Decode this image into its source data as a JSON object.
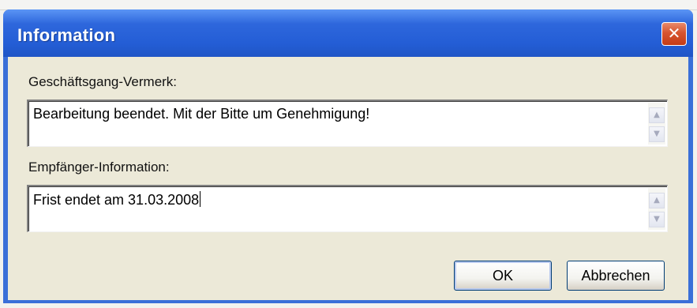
{
  "window": {
    "title": "Information",
    "close_symbol": "✕"
  },
  "fields": {
    "remark_label": "Geschäftsgang-Vermerk:",
    "remark_value": "Bearbeitung beendet. Mit der Bitte um Genehmigung!",
    "recipient_label": "Empfänger-Information:",
    "recipient_value": "Frist endet am 31.03.2008"
  },
  "buttons": {
    "ok_label": "OK",
    "cancel_label": "Abbrechen"
  },
  "icons": {
    "scroll_up": "▲",
    "scroll_down": "▼"
  },
  "colors": {
    "titlebar": "#245ed6",
    "dialog_body": "#ece9d8",
    "close_button": "#d7542f"
  }
}
